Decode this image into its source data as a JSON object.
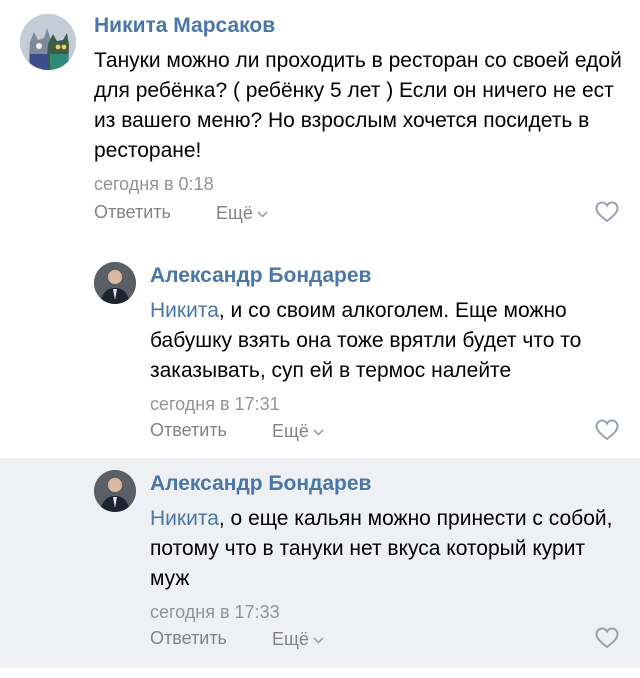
{
  "comments": [
    {
      "author": "Никита Марсаков",
      "mention": "",
      "text": "Тануки можно ли проходить в ресторан со своей едой для ребёнка? ( ребёнку 5 лет ) Если он ничего не ест из вашего меню? Но взрослым хочется посидеть в ресторане!",
      "time": "сегодня в 0:18",
      "reply_label": "Ответить",
      "more_label": "Ещё"
    },
    {
      "author": "Александр Бондарев",
      "mention": "Никита",
      "text": ", и со своим алкоголем. Еще можно бабушку взять она тоже врятли будет что то заказывать, суп ей в термос налейте",
      "time": "сегодня в 17:31",
      "reply_label": "Ответить",
      "more_label": "Ещё"
    },
    {
      "author": "Александр Бондарев",
      "mention": "Никита",
      "text": ", о еще кальян можно принести с собой, потому что в тануки нет вкуса который курит муж",
      "time": "сегодня в 17:33",
      "reply_label": "Ответить",
      "more_label": "Ещё"
    }
  ],
  "icons": {
    "like": "heart-outline-icon",
    "more": "chevron-down-icon"
  },
  "colors": {
    "link": "#4a76a8",
    "meta": "#939393",
    "highlight_bg": "#eef0f3"
  }
}
